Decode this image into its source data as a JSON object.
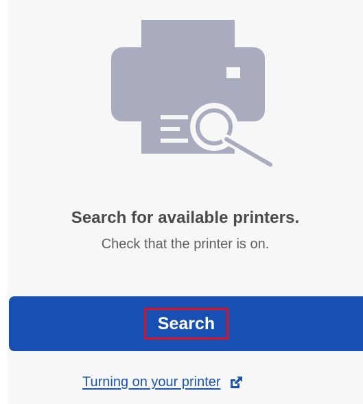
{
  "empty_state": {
    "icon": "printer-search-icon",
    "title": "Search for available printers.",
    "subtitle": "Check that the printer is on."
  },
  "actions": {
    "search_label": "Search"
  },
  "help": {
    "link_text": "Turning on your printer",
    "link_icon": "external-link-icon"
  },
  "colors": {
    "primary": "#1750b2",
    "illustration": "#a9abbe",
    "link": "#1a53b6",
    "highlight_border": "#e0101e",
    "panel_background": "#f7f7f7"
  }
}
